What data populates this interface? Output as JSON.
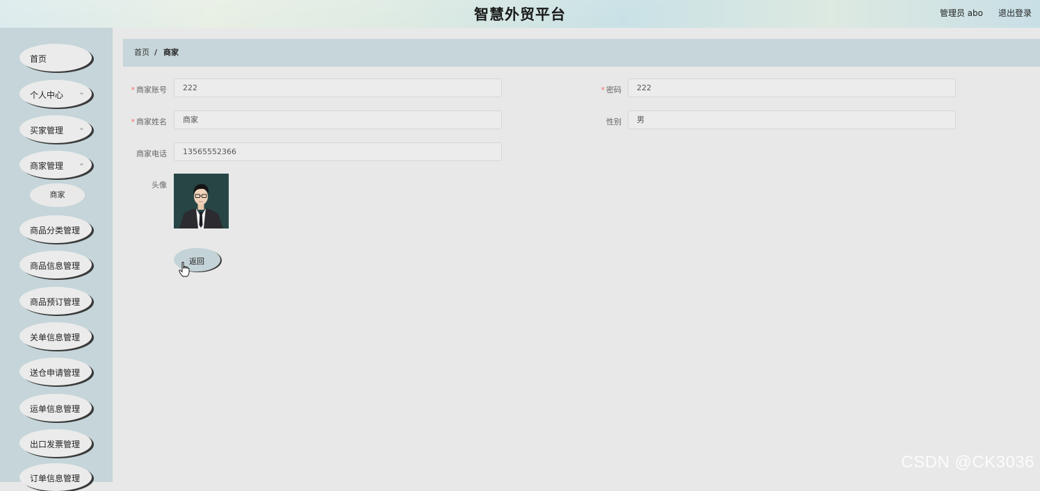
{
  "header": {
    "title": "智慧外贸平台",
    "user_text": "管理员 abo",
    "logout_label": "退出登录"
  },
  "sidebar": {
    "items": [
      {
        "label": "首页"
      },
      {
        "label": "个人中心",
        "expandable": true
      },
      {
        "label": "买家管理",
        "expandable": true
      },
      {
        "label": "商家管理",
        "expandable": true,
        "expanded": true
      },
      {
        "label": "商品分类管理"
      },
      {
        "label": "商品信息管理"
      },
      {
        "label": "商品预订管理"
      },
      {
        "label": "关单信息管理"
      },
      {
        "label": "送仓申请管理"
      },
      {
        "label": "运单信息管理"
      },
      {
        "label": "出口发票管理"
      },
      {
        "label": "订单信息管理"
      }
    ],
    "subitem": {
      "label": "商家"
    }
  },
  "breadcrumb": {
    "home": "首页",
    "separator": "/",
    "current": "商家"
  },
  "form": {
    "account": {
      "label": "商家账号",
      "required": true,
      "value": "222"
    },
    "password": {
      "label": "密码",
      "required": true,
      "value": "222"
    },
    "name": {
      "label": "商家姓名",
      "required": true,
      "value": "商家"
    },
    "gender": {
      "label": "性别",
      "value": "男"
    },
    "phone": {
      "label": "商家电话",
      "value": "13565552366"
    },
    "avatar": {
      "label": "头像"
    },
    "back_label": "返回"
  },
  "watermark": "CSDN @CK3036",
  "colors": {
    "sidebar_bg": "#c5d5d9",
    "breadcrumb_bg": "#c7d6da",
    "page_bg": "#e8e8e8",
    "required_mark": "#f56c6c"
  }
}
